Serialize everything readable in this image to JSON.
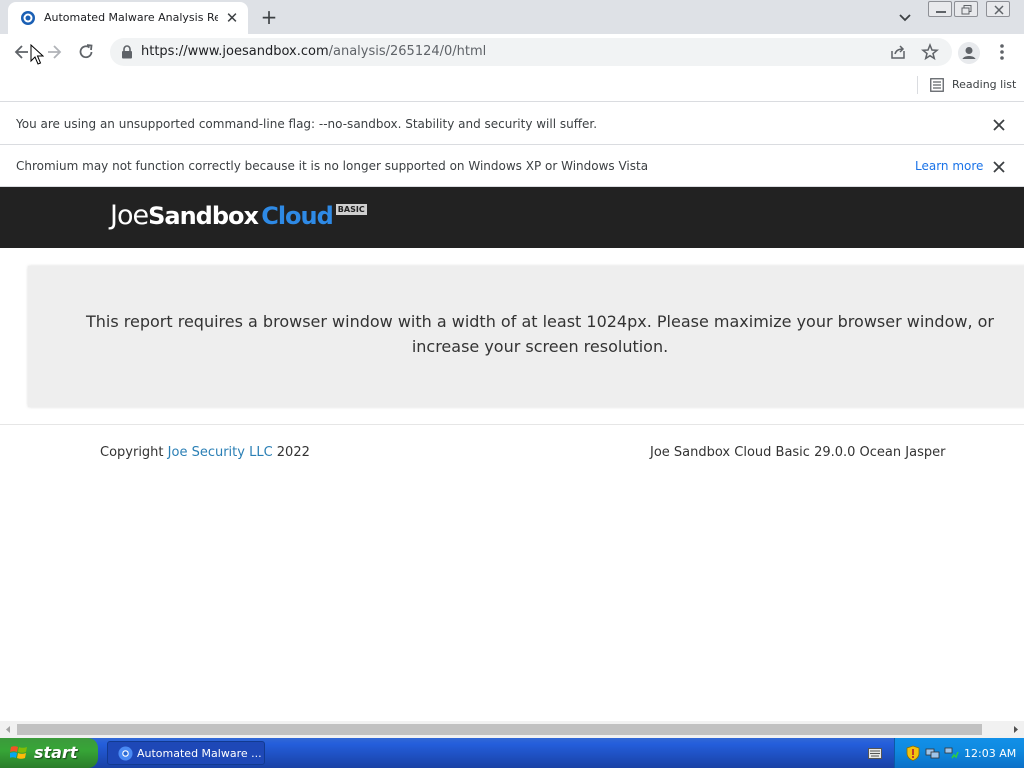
{
  "browser": {
    "tab_title": "Automated Malware Analysis Report",
    "url_host": "https://www.joesandbox.com",
    "url_path": "/analysis/265124/0/html",
    "reading_list_label": "Reading list"
  },
  "infobars": [
    {
      "text": "You are using an unsupported command-line flag: --no-sandbox. Stability and security will suffer."
    },
    {
      "text": "Chromium may not function correctly because it is no longer supported on Windows XP or Windows Vista",
      "link": "Learn more"
    }
  ],
  "page": {
    "logo": {
      "part1": "Joe",
      "part2": "Sandbox",
      "part3": "Cloud",
      "badge": "BASIC"
    },
    "notice_text": "This report requires a browser window with a width of at least 1024px. Please maximize your browser window, or increase your screen resolution.",
    "footer": {
      "copyright_prefix": "Copyright ",
      "copyright_link": "Joe Security LLC",
      "copyright_year": " 2022",
      "version": "Joe Sandbox Cloud Basic 29.0.0 Ocean Jasper"
    }
  },
  "taskbar": {
    "start_label": "start",
    "task_label": "Automated Malware ...",
    "clock": "12:03 AM"
  },
  "colors": {
    "accent_blue": "#2e8ae6",
    "link_blue": "#1a73e8",
    "header_bg": "#222222",
    "notice_bg": "#eeeeee"
  },
  "icons": [
    "favicon-icon",
    "close-icon",
    "plus-icon",
    "chevron-down-icon",
    "back-icon",
    "forward-icon",
    "reload-icon",
    "lock-icon",
    "share-icon",
    "star-icon",
    "profile-icon",
    "menu-icon",
    "reading-list-icon"
  ]
}
